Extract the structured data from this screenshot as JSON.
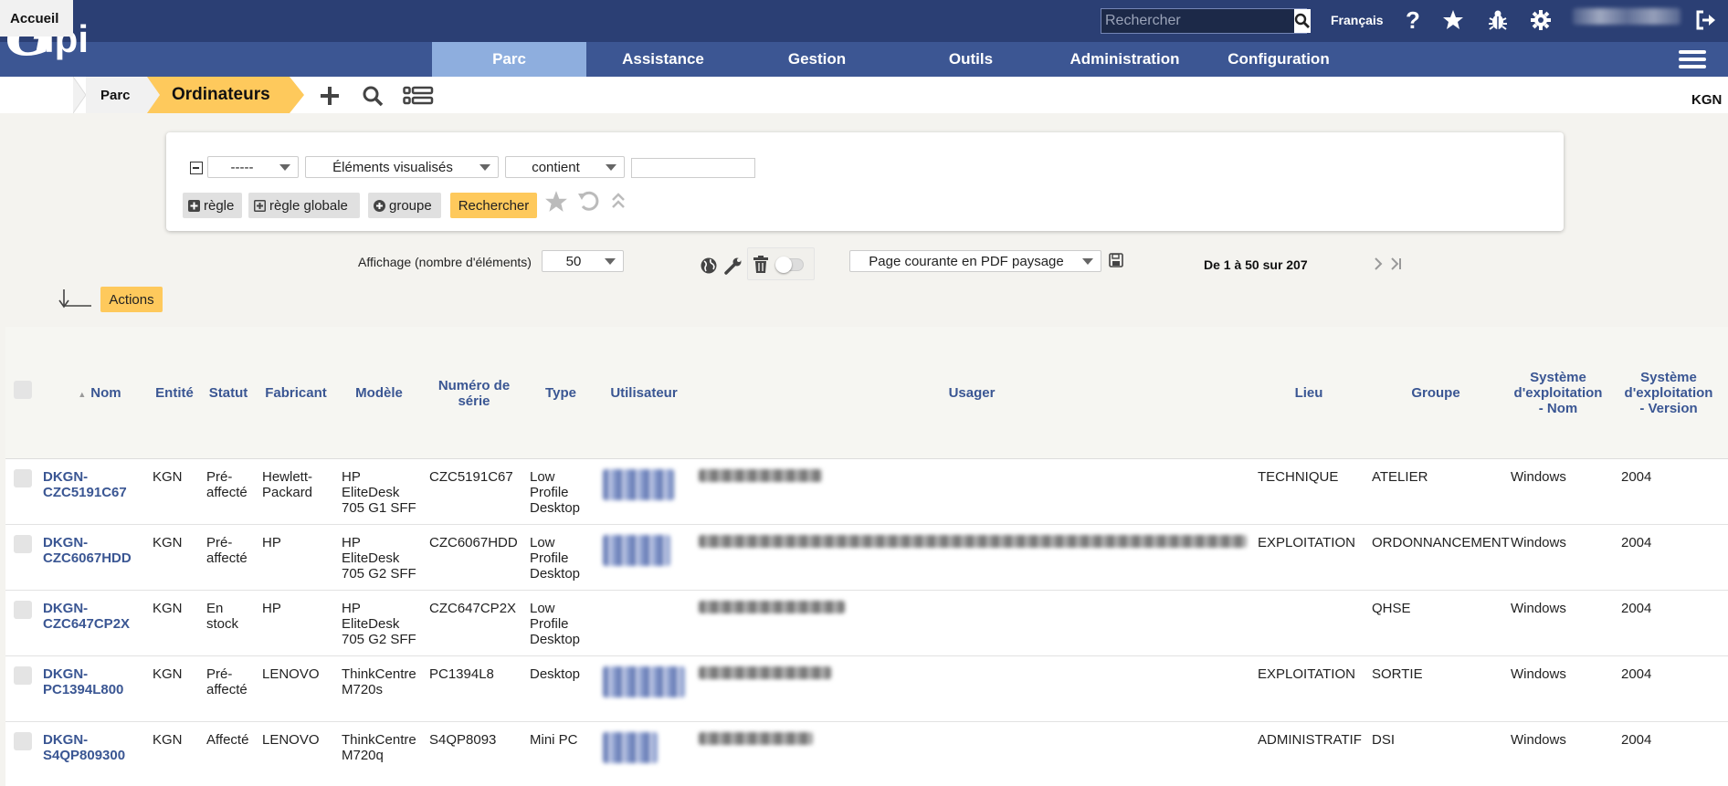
{
  "topbar": {
    "search_placeholder": "Rechercher",
    "language": "Français"
  },
  "menu": {
    "items": [
      {
        "label": "Parc",
        "active": true
      },
      {
        "label": "Assistance",
        "active": false
      },
      {
        "label": "Gestion",
        "active": false
      },
      {
        "label": "Outils",
        "active": false
      },
      {
        "label": "Administration",
        "active": false
      },
      {
        "label": "Configuration",
        "active": false
      }
    ]
  },
  "breadcrumb": {
    "home": "Accueil",
    "section": "Parc",
    "current": "Ordinateurs"
  },
  "entity": "KGN",
  "search_panel": {
    "field_select": "-----",
    "criterion_select": "Éléments visualisés",
    "operator_select": "contient",
    "value": "",
    "add_rule": "règle",
    "add_global_rule": "règle globale",
    "add_group": "groupe",
    "search_button": "Rechercher"
  },
  "display": {
    "label": "Affichage (nombre d'éléments)",
    "per_page": "50",
    "export_option": "Page courante en PDF paysage",
    "pagination": "De 1 à 50 sur 207"
  },
  "actions_button": "Actions",
  "table": {
    "headers": {
      "nom": "Nom",
      "entite": "Entité",
      "statut": "Statut",
      "fabricant": "Fabricant",
      "modele": "Modèle",
      "numero_l1": "Numéro de",
      "numero_l2": "série",
      "type": "Type",
      "utilisateur": "Utilisateur",
      "usager": "Usager",
      "lieu": "Lieu",
      "groupe": "Groupe",
      "os_nom_l1": "Système",
      "os_nom_l2": "d'exploitation",
      "os_nom_l3": "- Nom",
      "os_ver_l1": "Système",
      "os_ver_l2": "d'exploitation",
      "os_ver_l3": "- Version"
    },
    "rows": [
      {
        "nom_l1": "DKGN-",
        "nom_l2": "CZC5191C67",
        "entite": "KGN",
        "statut_l1": "Pré-",
        "statut_l2": "affecté",
        "fabricant_l1": "Hewlett-",
        "fabricant_l2": "Packard",
        "modele_l1": "HP",
        "modele_l2": "EliteDesk",
        "modele_l3": "705 G1 SFF",
        "serie": "CZC5191C67",
        "type_l1": "Low",
        "type_l2": "Profile",
        "type_l3": "Desktop",
        "lieu": "TECHNIQUE",
        "groupe": "ATELIER",
        "os_nom": "Windows",
        "os_version": "2004"
      },
      {
        "nom_l1": "DKGN-",
        "nom_l2": "CZC6067HDD",
        "entite": "KGN",
        "statut_l1": "Pré-",
        "statut_l2": "affecté",
        "fabricant_l1": "HP",
        "fabricant_l2": "",
        "modele_l1": "HP",
        "modele_l2": "EliteDesk",
        "modele_l3": "705 G2 SFF",
        "serie": "CZC6067HDD",
        "type_l1": "Low",
        "type_l2": "Profile",
        "type_l3": "Desktop",
        "lieu": "EXPLOITATION",
        "groupe": "ORDONNANCEMENT",
        "os_nom": "Windows",
        "os_version": "2004"
      },
      {
        "nom_l1": "DKGN-",
        "nom_l2": "CZC647CP2X",
        "entite": "KGN",
        "statut_l1": "En",
        "statut_l2": "stock",
        "fabricant_l1": "HP",
        "fabricant_l2": "",
        "modele_l1": "HP",
        "modele_l2": "EliteDesk",
        "modele_l3": "705 G2 SFF",
        "serie": "CZC647CP2X",
        "type_l1": "Low",
        "type_l2": "Profile",
        "type_l3": "Desktop",
        "lieu": "",
        "groupe": "QHSE",
        "os_nom": "Windows",
        "os_version": "2004"
      },
      {
        "nom_l1": "DKGN-",
        "nom_l2": "PC1394L800",
        "entite": "KGN",
        "statut_l1": "Pré-",
        "statut_l2": "affecté",
        "fabricant_l1": "LENOVO",
        "fabricant_l2": "",
        "modele_l1": "ThinkCentre",
        "modele_l2": "M720s",
        "modele_l3": "",
        "serie": "PC1394L8",
        "type_l1": "Desktop",
        "type_l2": "",
        "type_l3": "",
        "lieu": "EXPLOITATION",
        "groupe": "SORTIE",
        "os_nom": "Windows",
        "os_version": "2004"
      },
      {
        "nom_l1": "DKGN-",
        "nom_l2": "S4QP809300",
        "entite": "KGN",
        "statut_l1": "Affecté",
        "statut_l2": "",
        "fabricant_l1": "LENOVO",
        "fabricant_l2": "",
        "modele_l1": "ThinkCentre",
        "modele_l2": "M720q",
        "modele_l3": "",
        "serie": "S4QP8093",
        "type_l1": "Mini PC",
        "type_l2": "",
        "type_l3": "",
        "lieu": "ADMINISTRATIF",
        "groupe": "DSI",
        "os_nom": "Windows",
        "os_version": "2004"
      }
    ]
  },
  "colors": {
    "topbar": "#2b3f74",
    "navbar": "#3c5693",
    "active_menu": "#8eaede",
    "accent_yellow": "#fec95c",
    "link": "#3a5693"
  }
}
